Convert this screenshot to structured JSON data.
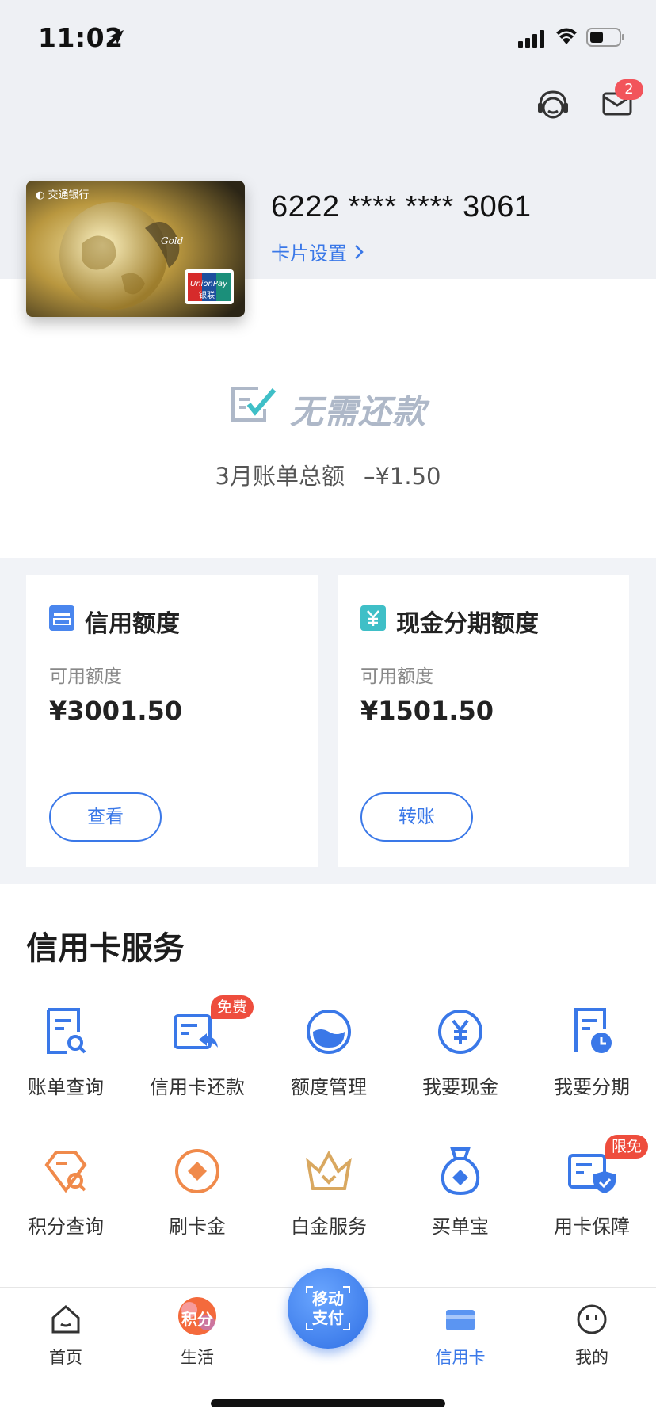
{
  "status_bar": {
    "time": "11:02"
  },
  "header": {
    "mail_badge": "2"
  },
  "card": {
    "number": "6222 **** **** 3061",
    "settings_label": "卡片设置"
  },
  "repayment": {
    "status": "无需还款",
    "bill_label": "3月账单总额",
    "bill_amount": "–¥1.50"
  },
  "panels": {
    "credit": {
      "title": "信用额度",
      "sub": "可用额度",
      "amount": "¥3001.50",
      "button": "查看"
    },
    "cash": {
      "title": "现金分期额度",
      "sub": "可用额度",
      "amount": "¥1501.50",
      "button": "转账"
    }
  },
  "services": {
    "title": "信用卡服务",
    "items": [
      {
        "label": "账单查询",
        "icon": "bill-search-icon"
      },
      {
        "label": "信用卡还款",
        "icon": "repay-icon",
        "badge": "免费"
      },
      {
        "label": "额度管理",
        "icon": "limit-icon"
      },
      {
        "label": "我要现金",
        "icon": "yuan-icon"
      },
      {
        "label": "我要分期",
        "icon": "installment-icon"
      },
      {
        "label": "积分查询",
        "icon": "points-icon"
      },
      {
        "label": "刷卡金",
        "icon": "reward-icon"
      },
      {
        "label": "白金服务",
        "icon": "crown-icon"
      },
      {
        "label": "买单宝",
        "icon": "bag-icon"
      },
      {
        "label": "用卡保障",
        "icon": "protection-icon",
        "badge": "限免"
      }
    ]
  },
  "tabbar": {
    "home": "首页",
    "life": "生活",
    "life_badge": "积分",
    "pay_line1": "移动",
    "pay_line2": "支付",
    "credit": "信用卡",
    "mine": "我的"
  },
  "colors": {
    "accent": "#3a78e8",
    "orange": "#f08a4b",
    "gold": "#d9a860",
    "badge": "#ee4d3d"
  }
}
